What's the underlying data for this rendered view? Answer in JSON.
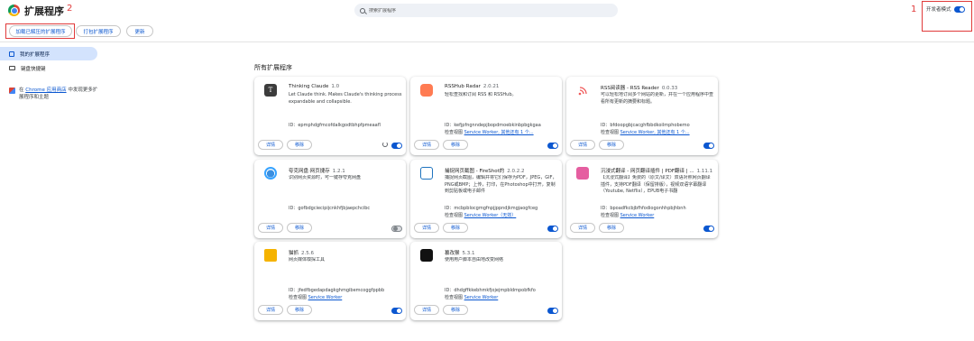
{
  "header": {
    "title": "扩展程序",
    "annot_2": "2",
    "annot_1": "1",
    "search_placeholder": "搜索扩展程序",
    "dev_mode_label": "开发者模式"
  },
  "toolbar": {
    "load_unpacked": "加载已解压的扩展程序",
    "pack": "打包扩展程序",
    "update": "更新"
  },
  "sidebar": {
    "items": [
      {
        "label": "我的扩展程序"
      },
      {
        "label": "键盘快捷键"
      }
    ],
    "store_note_prefix": "在 ",
    "store_link": "Chrome 应用商店",
    "store_note_suffix": " 中发现更多扩展程序和主题"
  },
  "section_title": "所有扩展程序",
  "cards": [
    {
      "name": "Thinking Claude",
      "version": "1.0",
      "desc": "Let Claude think. Makes Claude's thinking process expandable and collapsible.",
      "id": "ID：epmphdgfmcofdalkgodtbhpfpmeaafl",
      "view": "",
      "view_link": "",
      "details": "详情",
      "remove": "移除",
      "enabled": true
    },
    {
      "name": "RSSHub Radar",
      "version": "2.0.21",
      "desc": "轻松查找和订阅 RSS 和 RSSHub。",
      "id": "ID：kefjpfngnndepjbopdmoebkinbpbgkgaa",
      "view": "检查视图 ",
      "view_link": "Service Worker, 其他还有 1 个...",
      "details": "详情",
      "remove": "移除",
      "enabled": true
    },
    {
      "name": "RSS阅读器 - RSS Reader",
      "version": "0.0.33",
      "desc": "可以轻松地订阅多个网站的更新，并在一个应用程序中查看所有更新的摘要和标题。",
      "id": "ID：bfdoopgbjcacghfbbdkoilmphobemo",
      "view": "检查视图 ",
      "view_link": "Service Worker, 其他还有 1 个...",
      "details": "详情",
      "remove": "移除",
      "enabled": true
    },
    {
      "name": "夸克网盘·网页捷存",
      "version": "1.2.1",
      "desc": "识别网页资源时，可一键存夸克网盘",
      "id": "ID：gofbdgciecipijcnkhfjbjaepchcibc",
      "view": "",
      "view_link": "",
      "details": "详情",
      "remove": "移除",
      "enabled": false
    },
    {
      "name": "捕捉网页截图 - FireShot的",
      "version": "2.0.2.2",
      "desc": "捕捉网页截图，编辑并将它们保存为PDF，JPEG，GIF，PNG或BMP；上传，打印，在Photoshop中打开，复制到剪贴板或电子邮件",
      "id": "ID：mcbpblocgmgfnpjjppndjkmgjaogfceg",
      "view": "检查视图 ",
      "view_link": "Service Worker（无效）",
      "details": "详情",
      "remove": "移除",
      "enabled": true
    },
    {
      "name": "沉浸式翻译 - 网页翻译插件 | PDF翻译 | ...",
      "version": "1.11.1",
      "desc": "【沉浸式翻译】免费的（原文/译文）双语对照网页翻译插件，支持PDF翻译（保留排版），视频双语字幕翻译（Youtube, Netflix），EPUB电子书翻",
      "id": "ID：bpoadfkcbjbfhfodiogonhhpbjhbnh",
      "view": "检查视图 ",
      "view_link": "Service Worker",
      "details": "详情",
      "remove": "移除",
      "enabled": true
    },
    {
      "name": "猫抓",
      "version": "2.5.6",
      "desc": "网页媒体嗅探工具",
      "id": "ID：jfedfbgedapdagkghmgibemcoggfppbb",
      "view": "检查视图 ",
      "view_link": "Service Worker",
      "details": "详情",
      "remove": "移除",
      "enabled": true
    },
    {
      "name": "篡改猴",
      "version": "5.3.1",
      "desc": "使用用户脚本自由地改变网络",
      "id": "ID：dhdgffkkebhmkfjojejmpbldmpobfkfo",
      "view": "检查视图 ",
      "view_link": "Service Worker",
      "details": "详情",
      "remove": "移除",
      "enabled": true
    }
  ]
}
